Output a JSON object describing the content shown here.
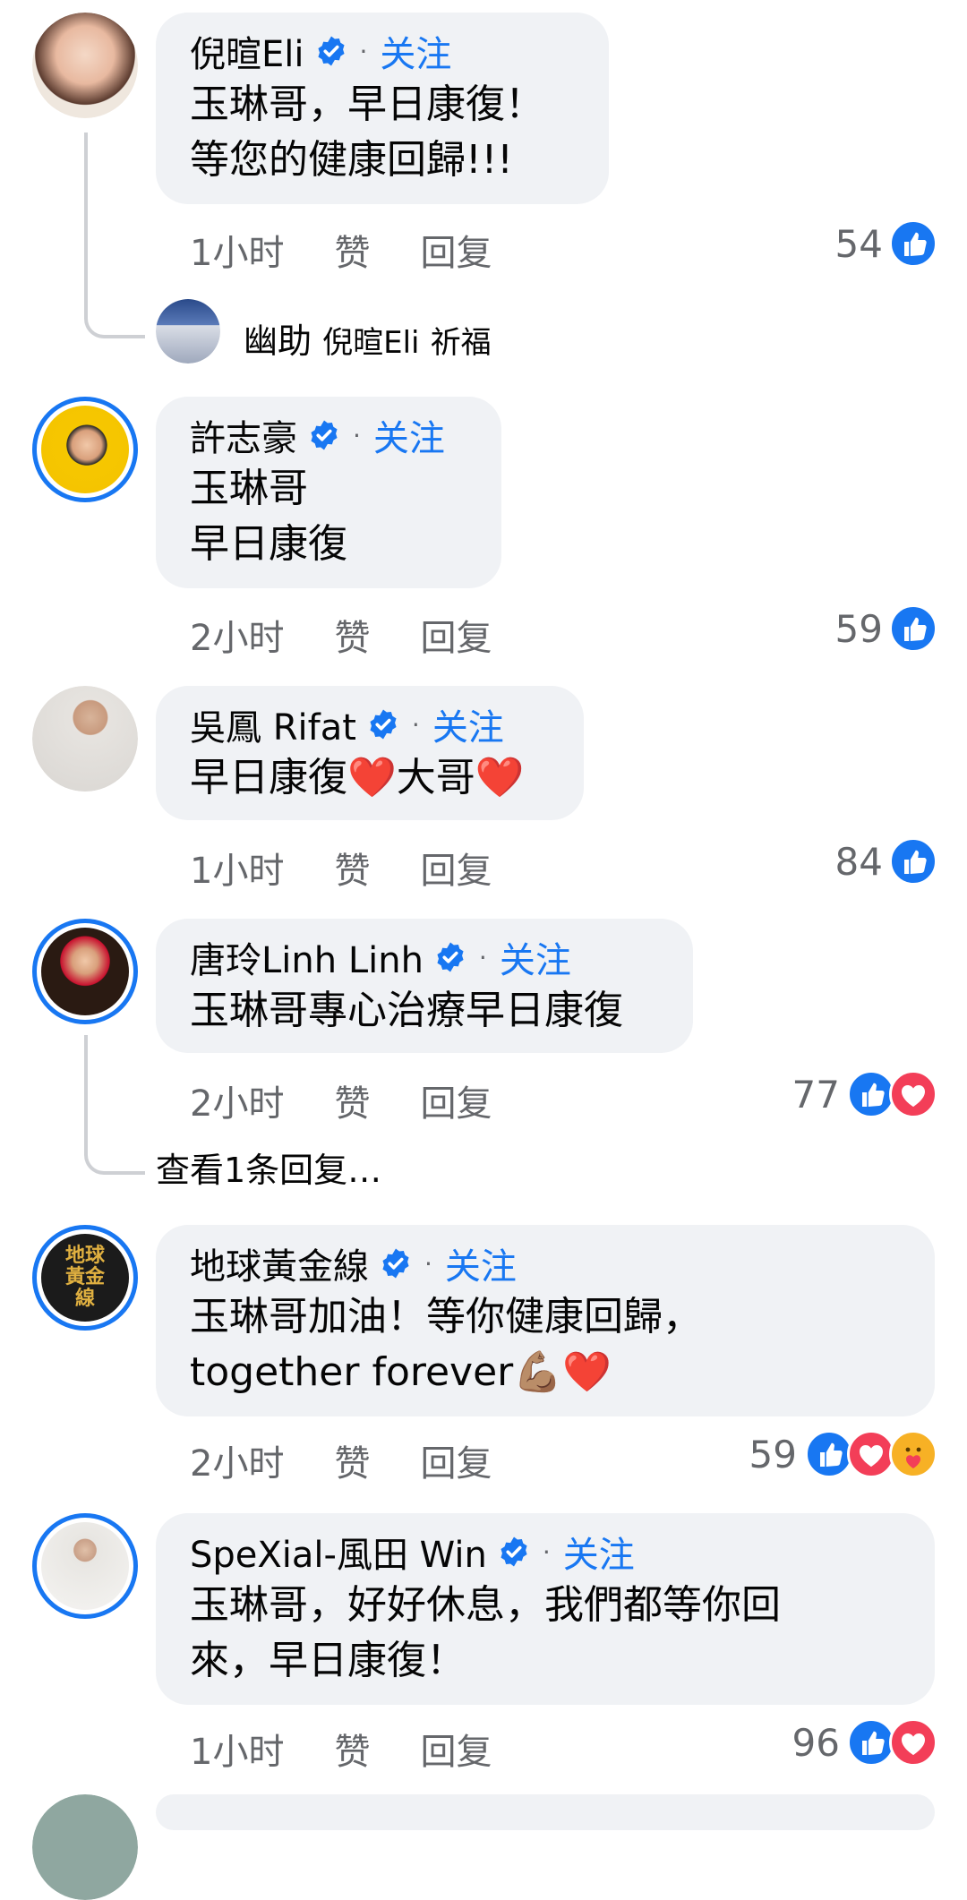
{
  "colors": {
    "accent": "#1877f2",
    "bubble": "#f0f2f5",
    "muted": "#65676b",
    "love": "#f33e58",
    "care": "#f7b125"
  },
  "follow_label": "关注",
  "like_label": "赞",
  "reply_label": "回复",
  "comments": [
    {
      "name": "倪暄Eli",
      "text": "玉琳哥，早日康復！\n等您的健康回歸!!!",
      "time": "1小时",
      "count": "54",
      "reactions": [
        "like"
      ]
    },
    {
      "name": "許志豪",
      "text": "玉琳哥\n早日康復",
      "time": "2小时",
      "count": "59",
      "reactions": [
        "like"
      ]
    },
    {
      "name": "吳鳳 Rifat",
      "text": "早日康復❤️大哥❤️",
      "time": "1小时",
      "count": "84",
      "reactions": [
        "like"
      ]
    },
    {
      "name": "唐玲Linh Linh",
      "text": "玉琳哥專心治療早日康復",
      "time": "2小时",
      "count": "77",
      "reactions": [
        "like",
        "love"
      ]
    },
    {
      "name": "地球黃金線",
      "text": "玉琳哥加油！等你健康回歸，\ntogether forever💪🏽❤️",
      "time": "2小时",
      "count": "59",
      "reactions": [
        "like",
        "love",
        "care"
      ]
    },
    {
      "name": "SpeXial-風田 Win",
      "text": "玉琳哥，好好休息，我們都等你回\n來，早日康復！",
      "time": "1小时",
      "count": "96",
      "reactions": [
        "like",
        "love"
      ]
    }
  ],
  "nested_reply": {
    "author": "幽助",
    "mention": "倪暄Eli",
    "text": "祈福"
  },
  "view_replies": "查看1条回复…",
  "avatar_logo_text": "地球黃金線"
}
